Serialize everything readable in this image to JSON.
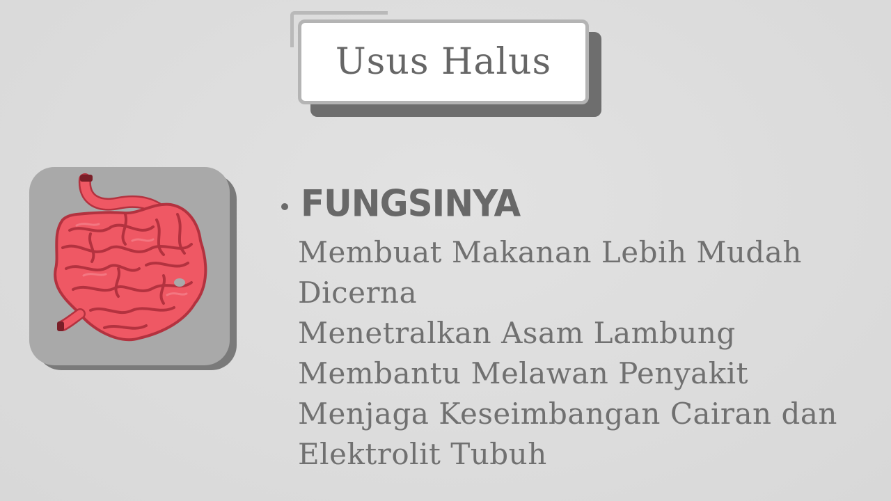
{
  "slide": {
    "title": "Usus Halus",
    "heading": "FUNGSINYA",
    "functions": [
      "Membuat Makanan Lebih Mudah Dicerna",
      "Menetralkan Asam Lambung",
      "Membantu Melawan Penyakit",
      "Menjaga Keseimbangan Cairan dan Elektrolit Tubuh"
    ],
    "image_icon": "small-intestine-illustration",
    "colors": {
      "background": "#dcdcdc",
      "text": "#707070",
      "intestine": "#ef5864",
      "intestine_dark": "#b3323f",
      "tile": "#a9a9a9"
    }
  }
}
